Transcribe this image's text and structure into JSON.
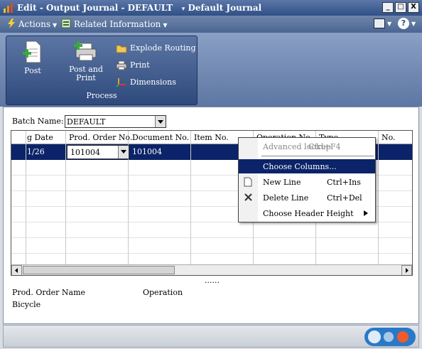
{
  "window": {
    "title": "Edit - Output Journal - DEFAULT",
    "subtitle": "Default Journal",
    "minimize": "_",
    "maximize": "□",
    "close": "X"
  },
  "cmdbar": {
    "actions": "Actions",
    "related": "Related Information",
    "help": "?"
  },
  "ribbon": {
    "post": "Post",
    "post_and_print": [
      "Post and",
      "Print"
    ],
    "explode_routing": "Explode Routing",
    "print": "Print",
    "dimensions": "Dimensions",
    "group": "Process"
  },
  "batch": {
    "label": "Batch Name:",
    "value": "DEFAULT"
  },
  "grid": {
    "headers": [
      "g Date",
      "Prod. Order No.",
      "Document No.",
      "Item No.",
      "Operation No.",
      "Type",
      "No."
    ],
    "row": {
      "date": "1/26",
      "prod_order": "101004",
      "document": "101004"
    }
  },
  "context_menu": {
    "items": [
      {
        "label": "Advanced lookup",
        "shortcut": "Ctrl+F4",
        "state": "disabled"
      },
      {
        "label": "Choose Columns...",
        "shortcut": "",
        "state": "highlighted"
      },
      {
        "label": "New Line",
        "shortcut": "Ctrl+Ins",
        "icon": "new-line-icon"
      },
      {
        "label": "Delete Line",
        "shortcut": "Ctrl+Del",
        "icon": "delete-icon"
      },
      {
        "label": "Choose Header Height",
        "shortcut": "",
        "submenu": true
      }
    ]
  },
  "splitter": "......",
  "info": {
    "prod_order_name_label": "Prod. Order Name",
    "operation_label": "Operation",
    "prod_order_name_value": "Bicycle"
  },
  "colors": {
    "titlebar": "#2f4f86",
    "selection": "#0b2368"
  }
}
